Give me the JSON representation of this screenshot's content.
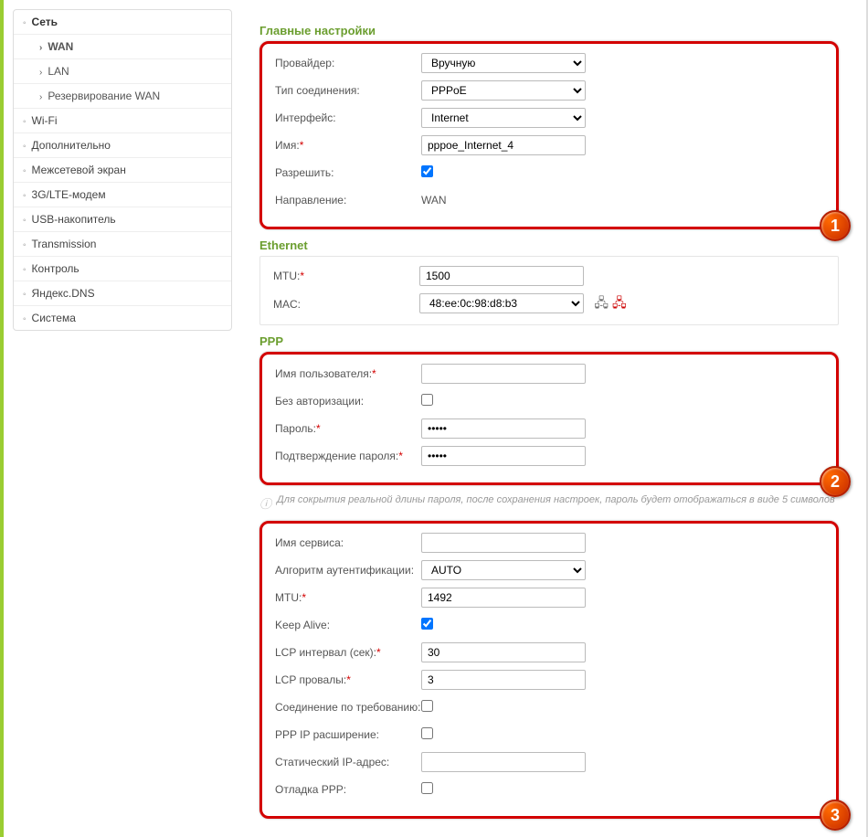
{
  "sidebar": {
    "items": [
      {
        "label": "Сеть",
        "type": "section"
      },
      {
        "label": "WAN",
        "type": "sub",
        "active": true
      },
      {
        "label": "LAN",
        "type": "sub"
      },
      {
        "label": "Резервирование WAN",
        "type": "sub"
      },
      {
        "label": "Wi-Fi",
        "type": "top"
      },
      {
        "label": "Дополнительно",
        "type": "top"
      },
      {
        "label": "Межсетевой экран",
        "type": "top"
      },
      {
        "label": "3G/LTE-модем",
        "type": "top"
      },
      {
        "label": "USB-накопитель",
        "type": "top"
      },
      {
        "label": "Transmission",
        "type": "top"
      },
      {
        "label": "Контроль",
        "type": "top"
      },
      {
        "label": "Яндекс.DNS",
        "type": "top"
      },
      {
        "label": "Система",
        "type": "top"
      }
    ]
  },
  "sections": {
    "main_title": "Главные настройки",
    "ethernet_title": "Ethernet",
    "ppp_title": "PPP"
  },
  "main": {
    "provider_label": "Провайдер:",
    "provider_value": "Вручную",
    "conn_type_label": "Тип соединения:",
    "conn_type_value": "PPPoE",
    "iface_label": "Интерфейс:",
    "iface_value": "Internet",
    "name_label": "Имя:",
    "name_value": "pppoe_Internet_4",
    "allow_label": "Разрешить:",
    "dir_label": "Направление:",
    "dir_value": "WAN"
  },
  "ethernet": {
    "mtu_label": "MTU:",
    "mtu_value": "1500",
    "mac_label": "MAC:",
    "mac_value": "48:ee:0c:98:d8:b3"
  },
  "ppp": {
    "user_label": "Имя пользователя:",
    "user_value": "",
    "noauth_label": "Без авторизации:",
    "pass_label": "Пароль:",
    "pass_value": "•••••",
    "pass2_label": "Подтверждение пароля:",
    "pass2_value": "•••••",
    "hint": "Для сокрытия реальной длины пароля, после сохранения настроек, пароль будет отображаться в виде 5 символов",
    "service_label": "Имя сервиса:",
    "service_value": "",
    "auth_label": "Алгоритм аутентификации:",
    "auth_value": "AUTO",
    "mtu_label": "MTU:",
    "mtu_value": "1492",
    "keepalive_label": "Keep Alive:",
    "lcp_int_label": "LCP интервал (сек):",
    "lcp_int_value": "30",
    "lcp_fail_label": "LCP провалы:",
    "lcp_fail_value": "3",
    "ondemand_label": "Соединение по требованию:",
    "pppip_label": "PPP IP расширение:",
    "static_ip_label": "Статический IP-адрес:",
    "static_ip_value": "",
    "debug_label": "Отладка PPP:"
  },
  "badges": {
    "b1": "1",
    "b2": "2",
    "b3": "3"
  }
}
